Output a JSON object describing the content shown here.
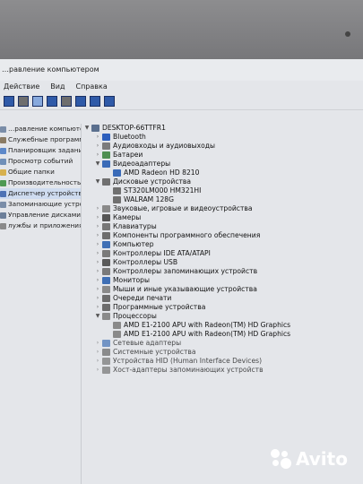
{
  "window": {
    "title": "…равление компьютером"
  },
  "menu": [
    "Действие",
    "Вид",
    "Справка"
  ],
  "left_items": [
    {
      "label": "…равление компьютером (л",
      "color": "#7a8da8",
      "selected": false
    },
    {
      "label": "Служебные программы",
      "color": "#8a7b64",
      "selected": false
    },
    {
      "label": "Планировщик заданий",
      "color": "#5c88c9",
      "selected": false
    },
    {
      "label": "Просмотр событий",
      "color": "#6f8fb8",
      "selected": false
    },
    {
      "label": "Общие папки",
      "color": "#d7b04e",
      "selected": false
    },
    {
      "label": "Производительность",
      "color": "#4f9a54",
      "selected": false
    },
    {
      "label": "Диспетчер устройств",
      "color": "#4d72b5",
      "selected": true
    },
    {
      "label": "Запоминающие устройст",
      "color": "#7a8da8",
      "selected": false
    },
    {
      "label": "Управление дисками",
      "color": "#6c7f9a",
      "selected": false
    },
    {
      "label": "лужбы и приложения",
      "color": "#8a8a8a",
      "selected": false
    }
  ],
  "tree": [
    {
      "label": "DESKTOP-66TTFR1",
      "indent": 0,
      "arrow": "▼",
      "icon": "#5a6f8e"
    },
    {
      "label": "Bluetooth",
      "indent": 1,
      "arrow": "›",
      "icon": "#2d5fbd"
    },
    {
      "label": "Аудиовходы и аудиовыходы",
      "indent": 1,
      "arrow": "›",
      "icon": "#7c7c7c"
    },
    {
      "label": "Батареи",
      "indent": 1,
      "arrow": "›",
      "icon": "#4f8f52"
    },
    {
      "label": "Видеоадаптеры",
      "indent": 1,
      "arrow": "▼",
      "icon": "#3a6bb8"
    },
    {
      "label": "AMD Radeon HD 8210",
      "indent": 2,
      "arrow": "",
      "icon": "#3a6bb8"
    },
    {
      "label": "Дисковые устройства",
      "indent": 1,
      "arrow": "▼",
      "icon": "#707070"
    },
    {
      "label": "ST320LM000 HM321HI",
      "indent": 2,
      "arrow": "",
      "icon": "#707070"
    },
    {
      "label": "WALRAM 128G",
      "indent": 2,
      "arrow": "",
      "icon": "#707070"
    },
    {
      "label": "Звуковые, игровые и видеоустройства",
      "indent": 1,
      "arrow": "›",
      "icon": "#8a8a8a"
    },
    {
      "label": "Камеры",
      "indent": 1,
      "arrow": "›",
      "icon": "#555555"
    },
    {
      "label": "Клавиатуры",
      "indent": 1,
      "arrow": "›",
      "icon": "#777777"
    },
    {
      "label": "Компоненты программного обеспечения",
      "indent": 1,
      "arrow": "›",
      "icon": "#6d6d6d"
    },
    {
      "label": "Компьютер",
      "indent": 1,
      "arrow": "›",
      "icon": "#3f6fb5"
    },
    {
      "label": "Контроллеры IDE ATA/ATAPI",
      "indent": 1,
      "arrow": "›",
      "icon": "#7a7a7a"
    },
    {
      "label": "Контроллеры USB",
      "indent": 1,
      "arrow": "›",
      "icon": "#5a5a5a"
    },
    {
      "label": "Контроллеры запоминающих устройств",
      "indent": 1,
      "arrow": "›",
      "icon": "#7a7a7a"
    },
    {
      "label": "Мониторы",
      "indent": 1,
      "arrow": "›",
      "icon": "#3f6fb5"
    },
    {
      "label": "Мыши и иные указывающие устройства",
      "indent": 1,
      "arrow": "›",
      "icon": "#8a8a8a"
    },
    {
      "label": "Очереди печати",
      "indent": 1,
      "arrow": "›",
      "icon": "#6d6d6d"
    },
    {
      "label": "Программные устройства",
      "indent": 1,
      "arrow": "›",
      "icon": "#6d6d6d"
    },
    {
      "label": "Процессоры",
      "indent": 1,
      "arrow": "▼",
      "icon": "#8a8a8a"
    },
    {
      "label": "AMD E1-2100 APU with Radeon(TM) HD Graphics",
      "indent": 2,
      "arrow": "",
      "icon": "#8a8a8a"
    },
    {
      "label": "AMD E1-2100 APU with Radeon(TM) HD Graphics",
      "indent": 2,
      "arrow": "",
      "icon": "#8a8a8a"
    },
    {
      "label": "Сетевые адаптеры",
      "indent": 1,
      "arrow": "›",
      "icon": "#4d79b8"
    },
    {
      "label": "Системные устройства",
      "indent": 1,
      "arrow": "›",
      "icon": "#6d6d6d"
    },
    {
      "label": "Устройства HID (Human Interface Devices)",
      "indent": 1,
      "arrow": "›",
      "icon": "#7a7a7a"
    },
    {
      "label": "Хост-адаптеры запоминающих устройств",
      "indent": 1,
      "arrow": "›",
      "icon": "#7a7a7a"
    }
  ],
  "watermark": "Avito"
}
